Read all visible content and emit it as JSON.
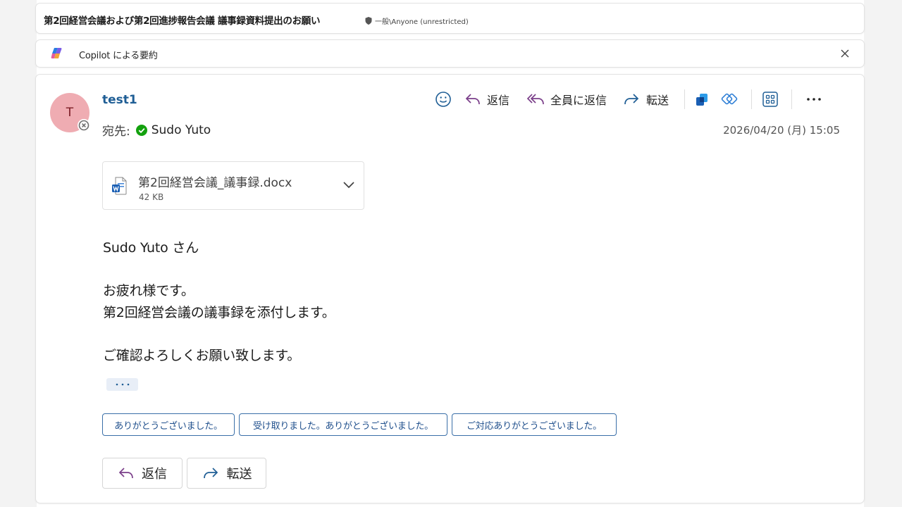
{
  "subject": {
    "title": "第2回経営会議および第2回進捗報告会議 議事録資料提出のお願い",
    "label": "一般\\Anyone (unrestricted)",
    "label_icon": "shield-icon"
  },
  "copilot": {
    "title": "Copilot による要約",
    "icon": "copilot-icon",
    "close_icon": "close-icon"
  },
  "message": {
    "avatar_initial": "T",
    "sender": "test1",
    "to_label": "宛先:",
    "recipient": "Sudo Yuto",
    "datetime": "2026/04/20 (月) 15:05",
    "toolbar": {
      "reply": "返信",
      "reply_all": "全員に返信",
      "forward": "転送",
      "icons": [
        "emoji-icon",
        "reply-icon",
        "reply-all-icon",
        "forward-icon",
        "copilot-icon",
        "loop-icon",
        "apps-icon",
        "more-icon"
      ]
    },
    "attachment": {
      "name": "第2回経営会議_議事録.docx",
      "size": "42 KB",
      "icon": "word-file-icon"
    },
    "body": {
      "greeting": "Sudo Yuto さん",
      "line1": "お疲れ様です。",
      "line2": "第2回経営会議の議事録を添付します。",
      "line3": "ご確認よろしくお願い致します。"
    },
    "suggested_replies": [
      "ありがとうございました。",
      "受け取りました。ありがとうございました。",
      "ご対応ありがとうございました。"
    ],
    "actions": {
      "reply": "返信",
      "forward": "転送"
    }
  },
  "colors": {
    "accent": "#1f5e95",
    "avatar_bg": "#efacb2",
    "presence_ok": "#13a10e",
    "suggest_border": "#3a6fa8"
  }
}
